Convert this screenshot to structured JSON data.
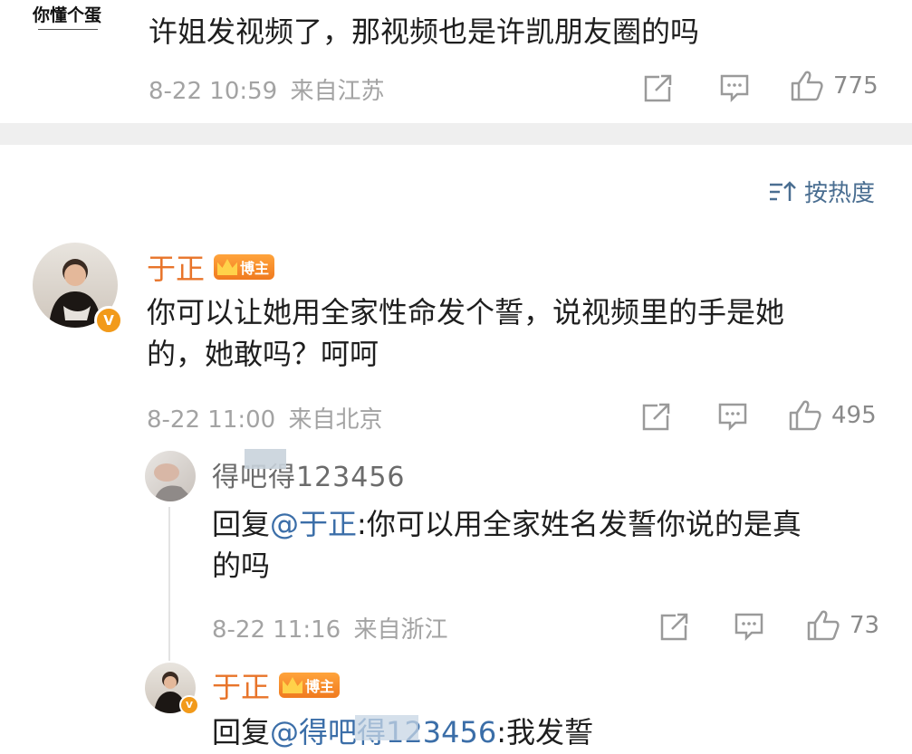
{
  "top_comment": {
    "username": "你懂个蛋",
    "text": "许姐发视频了，那视频也是许凯朋友圈的吗",
    "time": "8-22 10:59",
    "location": "来自江苏",
    "likes": "775"
  },
  "sort": {
    "label": "按热度",
    "icon": "sort-icon"
  },
  "main_comment": {
    "username": "于正",
    "badge": "博主",
    "text_line1": "你可以让她用全家性命发个誓，说视频里的手是她",
    "text_line2": "的，她敢吗？呵呵",
    "time": "8-22 11:00",
    "location": "来自北京",
    "likes": "495"
  },
  "reply1": {
    "username": "得吧得123456",
    "reply_prefix": "回复",
    "mention": "@于正",
    "text_line1": ":你可以用全家姓名发誓你说的是真",
    "text_line2": "的吗",
    "time": "8-22 11:16",
    "location": "来自浙江",
    "likes": "73"
  },
  "reply2": {
    "username": "于正",
    "badge": "博主",
    "reply_prefix": "回复",
    "mention": "@得吧得123456",
    "text": ":我发誓"
  },
  "colors": {
    "accent": "#e8742a",
    "link": "#3b6ea8",
    "meta": "#a3a3a3",
    "divider": "#efefef",
    "vip": "#f29a1a"
  }
}
